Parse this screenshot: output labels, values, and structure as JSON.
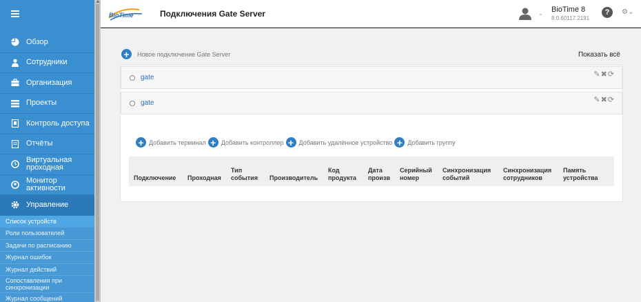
{
  "sidebar": {
    "items": [
      {
        "label": "Обзор",
        "icon": "pie-chart-icon"
      },
      {
        "label": "Сотрудники",
        "icon": "user-icon"
      },
      {
        "label": "Организация",
        "icon": "briefcase-icon"
      },
      {
        "label": "Проекты",
        "icon": "list-icon"
      },
      {
        "label": "Контроль доступа",
        "icon": "door-icon"
      },
      {
        "label": "Отчёты",
        "icon": "document-icon"
      },
      {
        "label": "Виртуальная проходная",
        "icon": "clock-icon"
      },
      {
        "label": "Монитор активности",
        "icon": "monitor-icon"
      },
      {
        "label": "Управление",
        "icon": "gear-icon"
      }
    ],
    "sub_items": [
      "Список устройств",
      "Роли пользователей",
      "Задачи по расписанию",
      "Журнал ошибок",
      "Журнал действий",
      "Сопоставления при синхронизации",
      "Журнал сообщений"
    ]
  },
  "header": {
    "logo_text": "BioTime",
    "title": "Подключения Gate Server",
    "brand_name": "BioTime 8",
    "version": "8.0.60117.2191"
  },
  "main": {
    "new_connection": "Новое подключение Gate Server",
    "show_all": "Показать всё",
    "connections": [
      "gate",
      "gate"
    ],
    "actions": {
      "add_terminal": "Добавить терминал",
      "add_controller": "Добавить контроллер",
      "add_remote": "Добавить удалённое устройство",
      "add_group": "Добавить группу"
    },
    "columns": [
      "Подключение",
      "Проходная",
      "Тип события",
      "Производитель",
      "Код продукта",
      "Дата произв",
      "Серийный номер",
      "Синхронизация событий",
      "Синхронизация сотрудников",
      "Память устройства"
    ]
  },
  "colors": {
    "sidebar": "#3a8fd0",
    "accent": "#2f7fc2",
    "link": "#2a6fb5"
  }
}
